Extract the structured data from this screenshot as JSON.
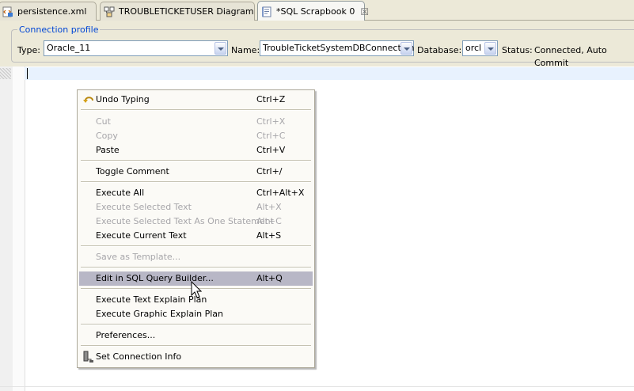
{
  "tabs": [
    {
      "label": "persistence.xml",
      "icon": "xml-file-icon"
    },
    {
      "label": "TROUBLETICKETUSER Diagram",
      "icon": "diagram-icon"
    },
    {
      "label": "*SQL Scrapbook 0",
      "icon": "sql-scrapbook-icon",
      "active": true,
      "close": "☒"
    }
  ],
  "connection": {
    "group_title": "Connection profile",
    "type_label": "Type:",
    "type_value": "Oracle_11",
    "name_label": "Name:",
    "name_value": "TroubleTicketSystemDBConnection",
    "database_label": "Database:",
    "database_value": "orcl",
    "status_label": "Status:",
    "status_value": "Connected, Auto Commit"
  },
  "context_menu": {
    "items": [
      {
        "label": "Undo Typing",
        "shortcut": "Ctrl+Z",
        "enabled": true,
        "icon": "undo-icon"
      },
      {
        "label": "Cut",
        "shortcut": "Ctrl+X",
        "enabled": false
      },
      {
        "label": "Copy",
        "shortcut": "Ctrl+C",
        "enabled": false
      },
      {
        "label": "Paste",
        "shortcut": "Ctrl+V",
        "enabled": true
      },
      {
        "label": "Toggle Comment",
        "shortcut": "Ctrl+/",
        "enabled": true
      },
      {
        "label": "Execute All",
        "shortcut": "Ctrl+Alt+X",
        "enabled": true
      },
      {
        "label": "Execute Selected Text",
        "shortcut": "Alt+X",
        "enabled": false
      },
      {
        "label": "Execute Selected Text As One Statement",
        "shortcut": "Alt+C",
        "enabled": false
      },
      {
        "label": "Execute Current Text",
        "shortcut": "Alt+S",
        "enabled": true
      },
      {
        "label": "Save as Template...",
        "shortcut": "",
        "enabled": false
      },
      {
        "label": "Edit in SQL Query Builder...",
        "shortcut": "Alt+Q",
        "enabled": true,
        "highlighted": true
      },
      {
        "label": "Execute Text Explain Plan",
        "shortcut": "",
        "enabled": true
      },
      {
        "label": "Execute Graphic Explain Plan",
        "shortcut": "",
        "enabled": true
      },
      {
        "label": "Preferences...",
        "shortcut": "",
        "enabled": true
      },
      {
        "label": "Set Connection Info",
        "shortcut": "",
        "enabled": true,
        "icon": "connection-info-icon"
      }
    ]
  },
  "colors": {
    "group_title": "#0046d5",
    "disabled_text": "#a7a6aa",
    "highlight": "#b8b7c6",
    "current_line": "#e8f2fe",
    "chrome": "#ece9d8"
  }
}
